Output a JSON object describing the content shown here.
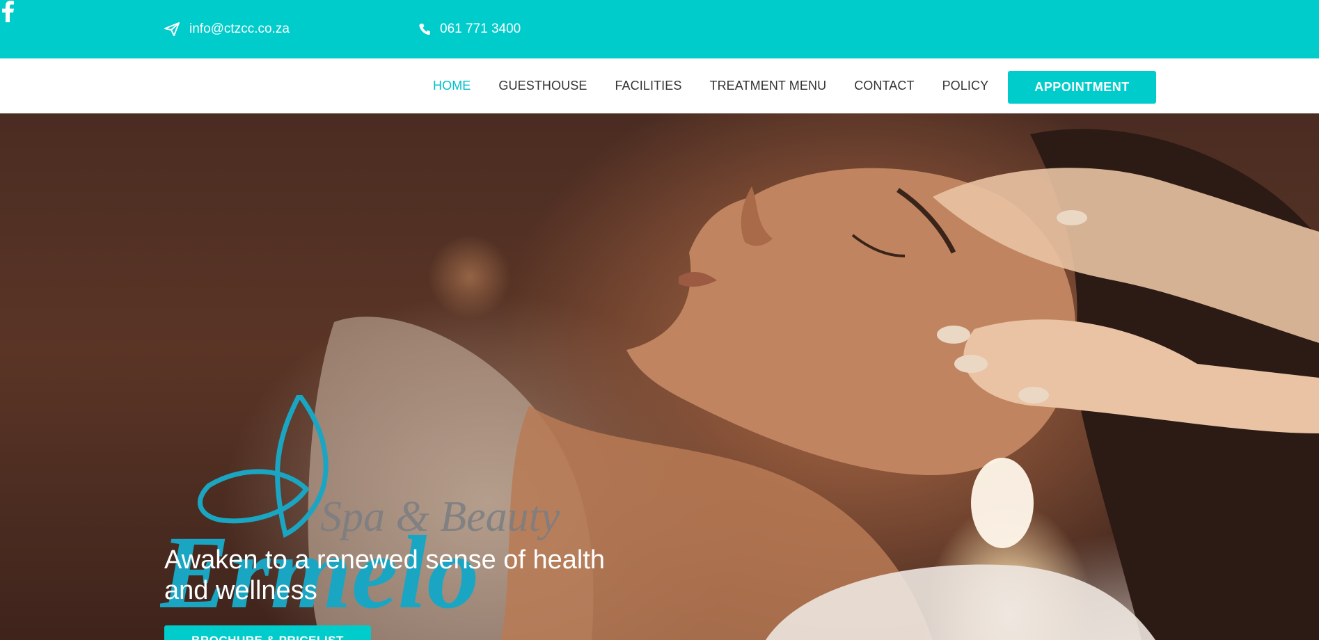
{
  "topbar": {
    "email": "info@ctzcc.co.za",
    "phone": "061 771 3400",
    "email_icon": "paper-plane-icon",
    "phone_icon": "phone-icon",
    "social_icon": "facebook-icon"
  },
  "nav": {
    "items": [
      {
        "label": "HOME",
        "active": true
      },
      {
        "label": "GUESTHOUSE"
      },
      {
        "label": "FACILITIES"
      },
      {
        "label": "TREATMENT MENU"
      },
      {
        "label": "CONTACT"
      },
      {
        "label": "POLICY"
      }
    ],
    "cta_label": "APPOINTMENT"
  },
  "hero": {
    "logo_text": "Ermelo",
    "logo_subtext": "Spa & Beauty",
    "tagline": "Awaken to a renewed sense of health and wellness",
    "button_label": "BROCHURE & PRICELIST"
  },
  "colors": {
    "accent": "#00cccc",
    "nav_active": "#00bfc8",
    "nav_text": "#333333",
    "logo_teal": "#1aa6c2",
    "logo_grey": "#7a7d82"
  }
}
